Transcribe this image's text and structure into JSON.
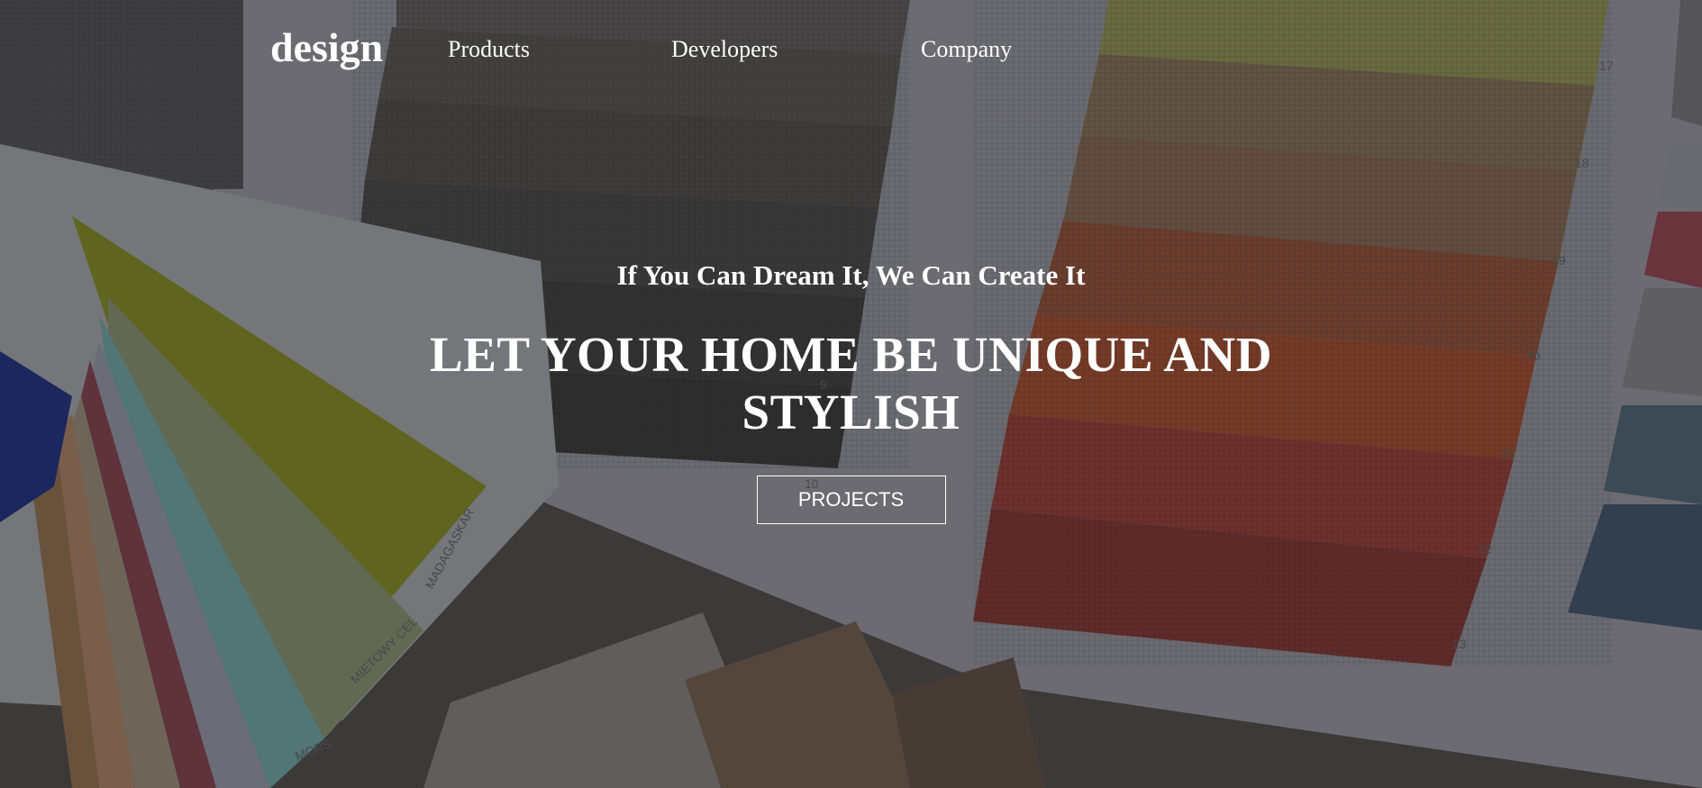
{
  "nav": {
    "logo": "design",
    "links": [
      {
        "label": "Products"
      },
      {
        "label": "Developers"
      },
      {
        "label": "Company"
      }
    ]
  },
  "hero": {
    "tagline": "If You Can Dream It, We Can Create It",
    "headline": "LET YOUR HOME BE UNIQUE AND STYLISH",
    "cta_label": "PROJECTS"
  },
  "colors": {
    "text": "#ffffff",
    "overlay": "#141418"
  },
  "background": {
    "fan_numbers": [
      "9",
      "10",
      "17",
      "18",
      "19",
      "20",
      "21",
      "22",
      "23"
    ],
    "fan_labels": [
      "MADAGASKAR",
      "MIETOWY CEL",
      "MORS"
    ]
  }
}
